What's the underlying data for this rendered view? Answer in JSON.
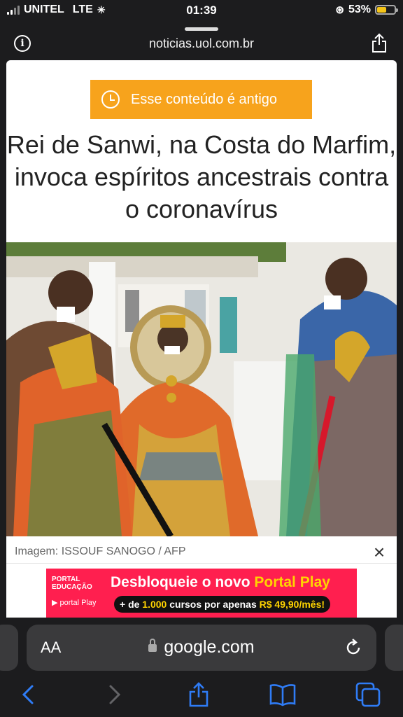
{
  "status_bar": {
    "carrier": "UNITEL",
    "network": "LTE",
    "time": "01:39",
    "battery_percent": "53%",
    "battery_level": 0.53,
    "accent": "#f5c518"
  },
  "browser": {
    "domain": "noticias.uol.com.br",
    "address": "google.com",
    "text_size_label": "AA"
  },
  "article": {
    "badge": "Esse conteúdo é antigo",
    "badge_color": "#f7a31c",
    "title": "Rei de Sanwi, na Costa do Marfim, invoca espíritos ancestrais contra o coronavírus",
    "image_caption": "Imagem: ISSOUF SANOGO / AFP"
  },
  "ad": {
    "brand_line1": "PORTAL",
    "brand_line2": "EDUCAÇÃO",
    "brand_sub": "portal Play",
    "headline_pre": "Desbloqueie o novo",
    "headline_highlight": "Portal Play",
    "offer_pre": "+ de",
    "offer_count": "1.000",
    "offer_mid": "cursos por apenas",
    "offer_price": "R$ 49,90/mês!",
    "background": "#ff1f4f"
  },
  "toolbar": {
    "icons": [
      "back-icon",
      "forward-icon",
      "share-icon",
      "bookmarks-icon",
      "tabs-icon"
    ],
    "accent": "#2f7cf6"
  }
}
